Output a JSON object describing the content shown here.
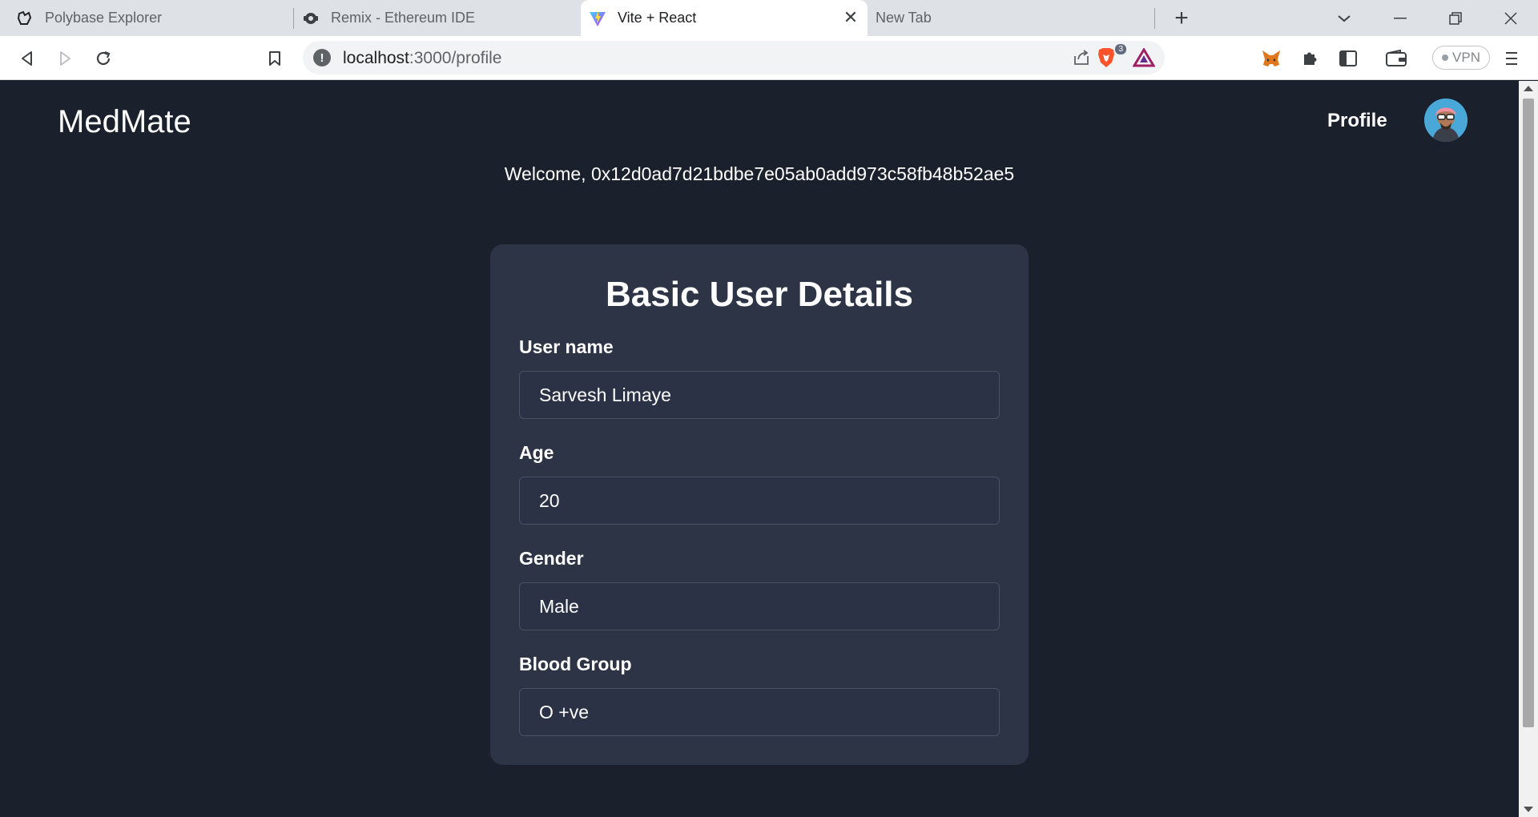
{
  "browser": {
    "tabs": [
      {
        "title": "Polybase Explorer",
        "icon": "polybase-icon",
        "active": false
      },
      {
        "title": "Remix - Ethereum IDE",
        "icon": "remix-icon",
        "active": false
      },
      {
        "title": "Vite + React",
        "icon": "vite-icon",
        "active": true
      },
      {
        "title": "New Tab",
        "icon": "",
        "active": false
      }
    ],
    "address": {
      "host": "localhost",
      "path": ":3000/profile"
    },
    "shields_count": "3",
    "vpn_label": "VPN"
  },
  "app": {
    "brand": "MedMate",
    "nav_profile": "Profile",
    "welcome": "Welcome, 0x12d0ad7d21bdbe7e05ab0add973c58fb48b52ae5"
  },
  "card": {
    "title": "Basic User Details",
    "fields": [
      {
        "label": "User name",
        "value": "Sarvesh Limaye"
      },
      {
        "label": "Age",
        "value": "20"
      },
      {
        "label": "Gender",
        "value": "Male"
      },
      {
        "label": "Blood Group",
        "value": "O +ve"
      }
    ]
  },
  "colors": {
    "page_bg": "#1b202d",
    "card_bg": "#2d3446",
    "input_border": "#4a5163",
    "text": "#ffffff"
  }
}
